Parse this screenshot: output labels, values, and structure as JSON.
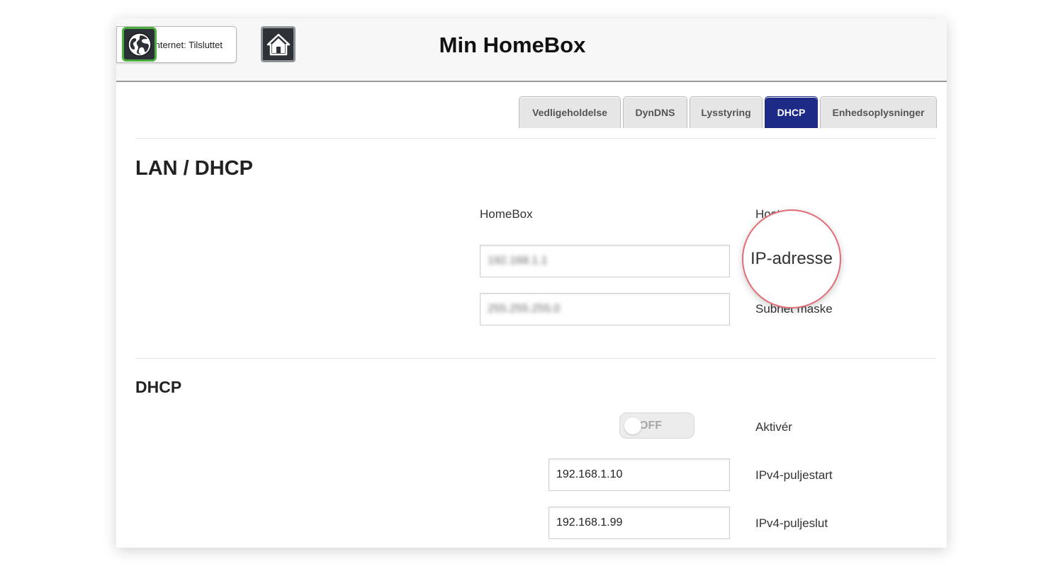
{
  "header": {
    "internet_status": "Internet: Tilsluttet",
    "title": "Min HomeBox"
  },
  "tabs": [
    {
      "label": "Vedligeholdelse",
      "active": false
    },
    {
      "label": "DynDNS",
      "active": false
    },
    {
      "label": "Lysstyring",
      "active": false
    },
    {
      "label": "DHCP",
      "active": true
    },
    {
      "label": "Enhedsoplysninger",
      "active": false
    }
  ],
  "lan": {
    "title": "LAN / DHCP",
    "col_homebox": "HomeBox",
    "col_host": "Host",
    "ip_value": "192.168.1.1",
    "subnet_value": "255.255.255.0",
    "subnet_label": "Subnet maske",
    "ip_label_zoomed": "IP-adresse"
  },
  "dhcp": {
    "title": "DHCP",
    "toggle_state": "OFF",
    "activate_label": "Aktivér",
    "pool_start_value": "192.168.1.10",
    "pool_start_label": "IPv4-puljestart",
    "pool_end_value": "192.168.1.99",
    "pool_end_label": "IPv4-puljeslut"
  },
  "colors": {
    "accent_active_tab": "#1d2a86",
    "status_ok": "#4cae3f",
    "highlight_ring": "#e06d78"
  },
  "icons": {
    "status": "globe-icon",
    "home": "home-icon"
  }
}
